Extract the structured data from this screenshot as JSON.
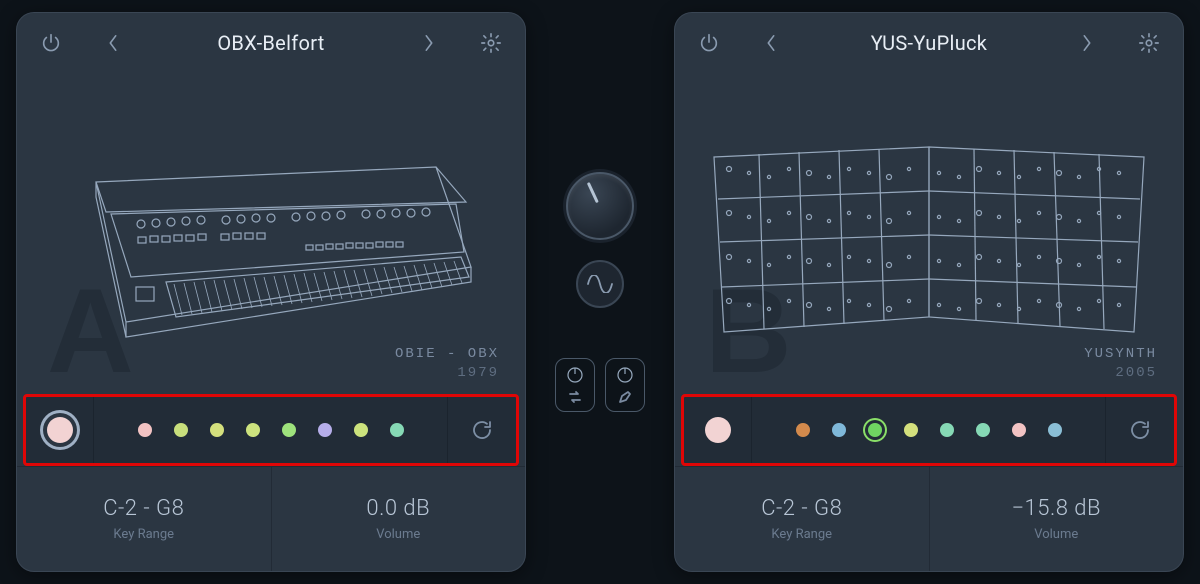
{
  "slots": {
    "A": {
      "letter": "A",
      "preset_name": "OBX-Belfort",
      "synth_maker": "OBIE - OBX",
      "synth_year": "1979",
      "key_range": "C-2  -  G8",
      "key_range_label": "Key Range",
      "volume": "0.0 dB",
      "volume_label": "Volume",
      "preset_dots": [
        {
          "color": "#f2c3c3"
        },
        {
          "color": "#c8df7c"
        },
        {
          "color": "#d4e07d"
        },
        {
          "color": "#cde37e"
        },
        {
          "color": "#9ee27c"
        },
        {
          "color": "#b6aeea"
        },
        {
          "color": "#cce37d"
        },
        {
          "color": "#86d9b5"
        }
      ],
      "selected_dot": -1,
      "big_dot_selected": true
    },
    "B": {
      "letter": "B",
      "preset_name": "YUS-YuPluck",
      "synth_maker": "YUSYNTH",
      "synth_year": "2005",
      "key_range": "C-2  -  G8",
      "key_range_label": "Key Range",
      "volume": "−15.8 dB",
      "volume_label": "Volume",
      "preset_dots": [
        {
          "color": "#d38a4c"
        },
        {
          "color": "#7fb8d9"
        },
        {
          "color": "#6fd561"
        },
        {
          "color": "#d4e07d"
        },
        {
          "color": "#86d9b5"
        },
        {
          "color": "#86d9b5"
        },
        {
          "color": "#f2c3c3"
        },
        {
          "color": "#8bbfd6"
        }
      ],
      "selected_dot": 2,
      "big_dot_selected": false
    }
  }
}
